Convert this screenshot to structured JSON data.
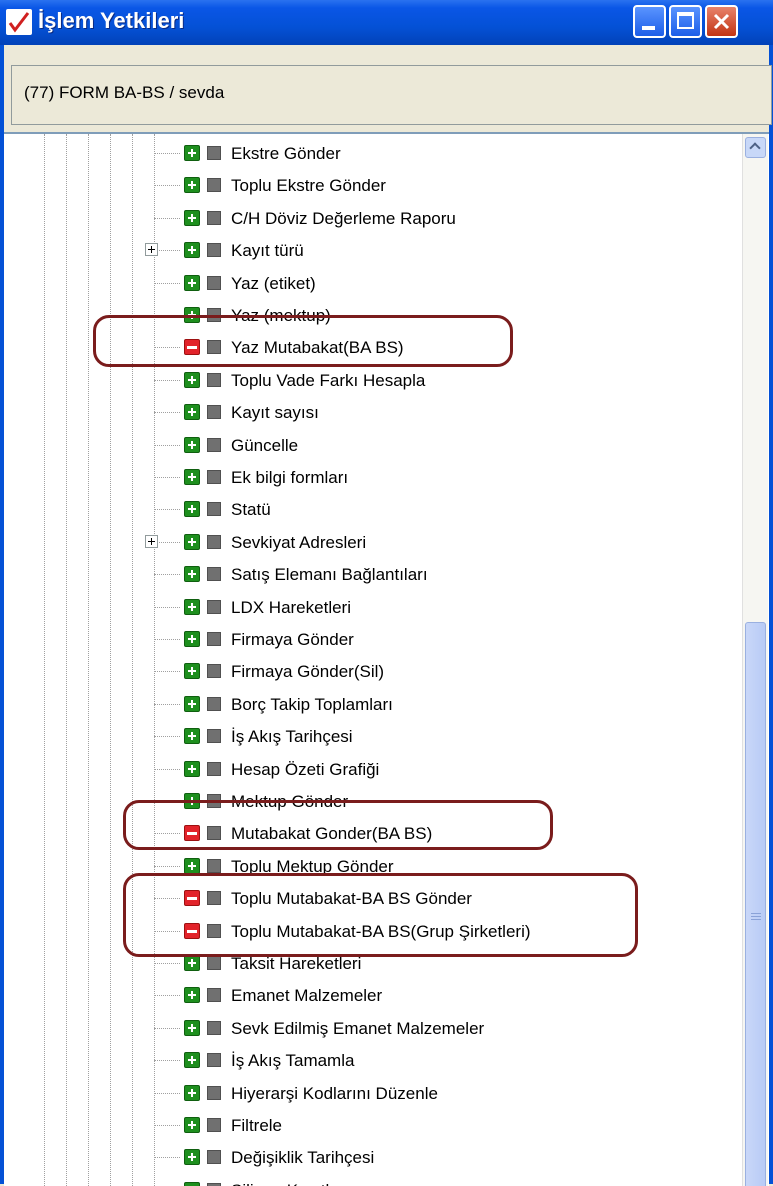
{
  "window": {
    "title": "İşlem Yetkileri",
    "app_icon": "checkmark-app-icon",
    "buttons": {
      "minimize": "minimize-icon",
      "maximize": "maximize-icon",
      "close": "close-icon"
    }
  },
  "header": {
    "text": "(77) FORM BA-BS / sevda"
  },
  "tree": {
    "items": [
      {
        "label": "Ekstre Gönder",
        "state": "granted",
        "expandable": false
      },
      {
        "label": "Toplu Ekstre Gönder",
        "state": "granted",
        "expandable": false
      },
      {
        "label": "C/H Döviz Değerleme Raporu",
        "state": "granted",
        "expandable": false
      },
      {
        "label": "Kayıt türü",
        "state": "granted",
        "expandable": true
      },
      {
        "label": "Yaz (etiket)",
        "state": "granted",
        "expandable": false
      },
      {
        "label": "Yaz (mektup)",
        "state": "granted",
        "expandable": false
      },
      {
        "label": "Yaz Mutabakat(BA BS)",
        "state": "denied",
        "expandable": false
      },
      {
        "label": "Toplu Vade Farkı Hesapla",
        "state": "granted",
        "expandable": false
      },
      {
        "label": "Kayıt sayısı",
        "state": "granted",
        "expandable": false
      },
      {
        "label": "Güncelle",
        "state": "granted",
        "expandable": false
      },
      {
        "label": "Ek bilgi formları",
        "state": "granted",
        "expandable": false
      },
      {
        "label": "Statü",
        "state": "granted",
        "expandable": false
      },
      {
        "label": "Sevkiyat Adresleri",
        "state": "granted",
        "expandable": true
      },
      {
        "label": "Satış Elemanı Bağlantıları",
        "state": "granted",
        "expandable": false
      },
      {
        "label": "LDX Hareketleri",
        "state": "granted",
        "expandable": false
      },
      {
        "label": "Firmaya Gönder",
        "state": "granted",
        "expandable": false
      },
      {
        "label": "Firmaya Gönder(Sil)",
        "state": "granted",
        "expandable": false
      },
      {
        "label": "Borç Takip Toplamları",
        "state": "granted",
        "expandable": false
      },
      {
        "label": "İş Akış Tarihçesi",
        "state": "granted",
        "expandable": false
      },
      {
        "label": "Hesap Özeti Grafiği",
        "state": "granted",
        "expandable": false
      },
      {
        "label": "Mektup Gönder",
        "state": "granted",
        "expandable": false
      },
      {
        "label": "Mutabakat Gonder(BA BS)",
        "state": "denied",
        "expandable": false
      },
      {
        "label": "Toplu Mektup Gönder",
        "state": "granted",
        "expandable": false
      },
      {
        "label": "Toplu Mutabakat-BA BS Gönder",
        "state": "denied",
        "expandable": false
      },
      {
        "label": "Toplu Mutabakat-BA BS(Grup Şirketleri)",
        "state": "denied",
        "expandable": false
      },
      {
        "label": "Taksit Hareketleri",
        "state": "granted",
        "expandable": false
      },
      {
        "label": "Emanet Malzemeler",
        "state": "granted",
        "expandable": false
      },
      {
        "label": "Sevk Edilmiş Emanet Malzemeler",
        "state": "granted",
        "expandable": false
      },
      {
        "label": "İş Akış Tamamla",
        "state": "granted",
        "expandable": false
      },
      {
        "label": "Hiyerarşi Kodlarını Düzenle",
        "state": "granted",
        "expandable": false
      },
      {
        "label": "Filtrele",
        "state": "granted",
        "expandable": false
      },
      {
        "label": "Değişiklik Tarihçesi",
        "state": "granted",
        "expandable": false
      },
      {
        "label": "Silinen Kayıtlar",
        "state": "granted",
        "expandable": false
      }
    ]
  },
  "colors": {
    "granted": "#1e8f1e",
    "denied": "#e2232a",
    "highlight_border": "#7a1c1c",
    "title_bar": "#0451d6"
  }
}
